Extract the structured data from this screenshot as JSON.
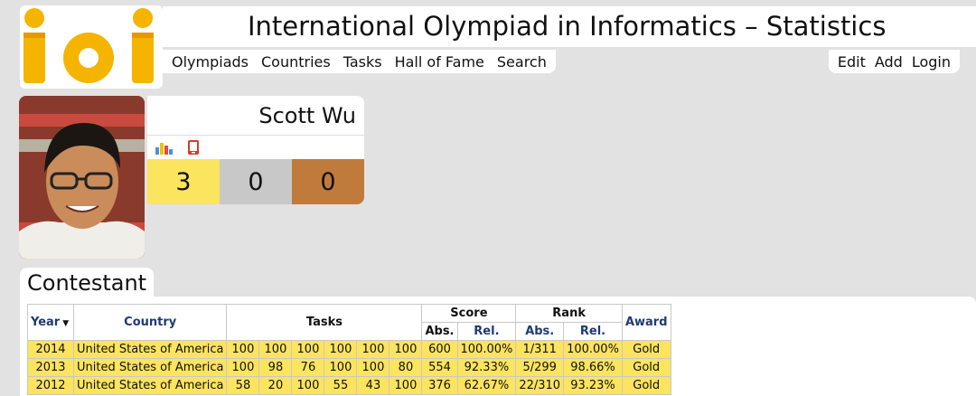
{
  "header": {
    "title": "International Olympiad in Informatics – Statistics",
    "logo_text": "ioi",
    "nav_left": [
      "Olympiads",
      "Countries",
      "Tasks",
      "Hall of Fame",
      "Search"
    ],
    "nav_right": [
      "Edit",
      "Add",
      "Login"
    ]
  },
  "profile": {
    "name": "Scott Wu",
    "icons": [
      "bar-chart-icon",
      "mobile-icon"
    ],
    "medals": {
      "gold": "3",
      "silver": "0",
      "bronze": "0"
    }
  },
  "section": {
    "title": "Contestant"
  },
  "table": {
    "headers": {
      "year": "Year",
      "country": "Country",
      "tasks": "Tasks",
      "score": "Score",
      "rank": "Rank",
      "award": "Award",
      "abs": "Abs.",
      "rel": "Rel."
    },
    "rows": [
      {
        "year": "2014",
        "country": "United States of America",
        "tasks": [
          "100",
          "100",
          "100",
          "100",
          "100",
          "100"
        ],
        "score_abs": "600",
        "score_rel": "100.00%",
        "rank_abs": "1/311",
        "rank_rel": "100.00%",
        "award": "Gold"
      },
      {
        "year": "2013",
        "country": "United States of America",
        "tasks": [
          "100",
          "98",
          "76",
          "100",
          "100",
          "80"
        ],
        "score_abs": "554",
        "score_rel": "92.33%",
        "rank_abs": "5/299",
        "rank_rel": "98.66%",
        "award": "Gold"
      },
      {
        "year": "2012",
        "country": "United States of America",
        "tasks": [
          "58",
          "20",
          "100",
          "55",
          "43",
          "100"
        ],
        "score_abs": "376",
        "score_rel": "62.67%",
        "rank_abs": "22/310",
        "rank_rel": "93.23%",
        "award": "Gold"
      }
    ]
  },
  "colors": {
    "gold": "#fbe45e",
    "silver": "#c8c8c8",
    "bronze": "#c07a3c",
    "logo": "#f4b400",
    "header_link": "#1f3a72"
  }
}
